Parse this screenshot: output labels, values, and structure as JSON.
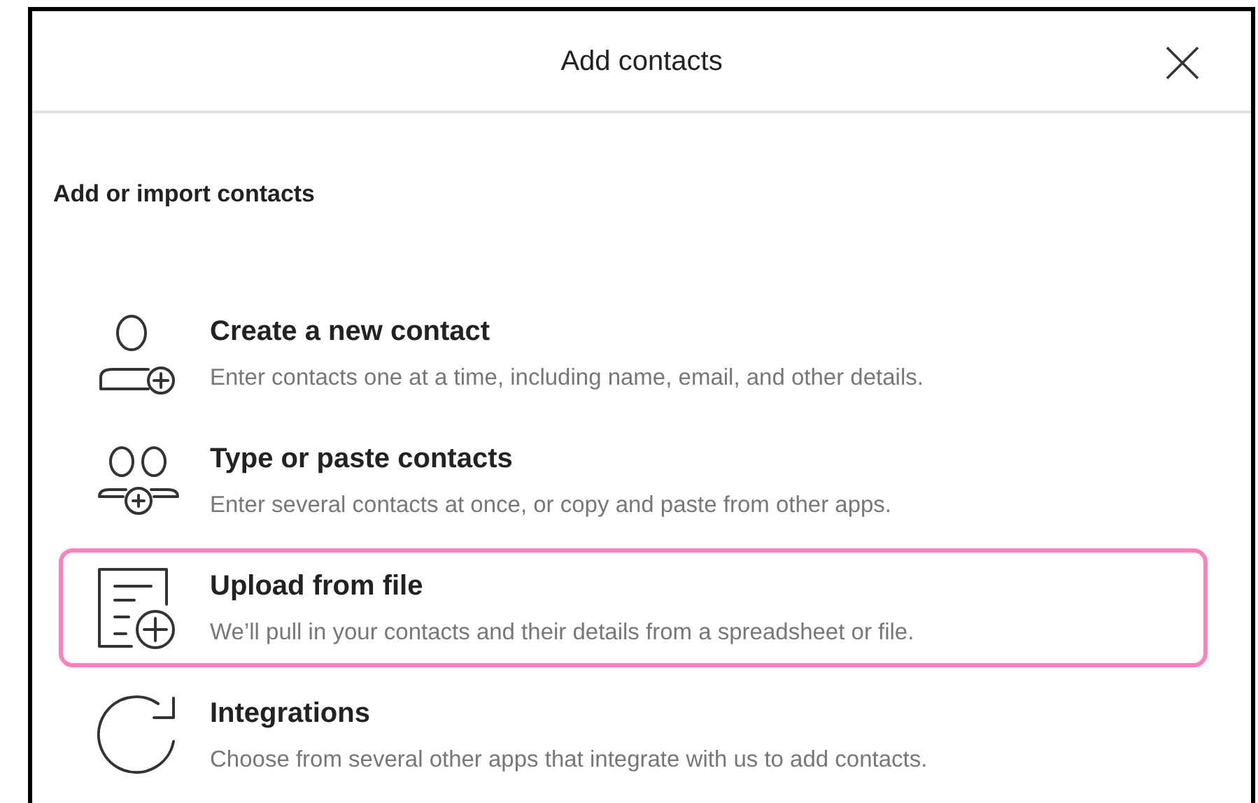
{
  "dialog": {
    "title": "Add contacts",
    "section_heading": "Add or import contacts",
    "options": [
      {
        "kind": "person",
        "title": "Create a new contact",
        "description": "Enter contacts one at a time, including name, email, and other details.",
        "selected": false
      },
      {
        "kind": "people",
        "title": "Type or paste contacts",
        "description": "Enter several contacts at once, or copy and paste from other apps.",
        "selected": false
      },
      {
        "kind": "file",
        "title": "Upload from file",
        "description": "We’ll pull in your contacts and their details from a spreadsheet or file.",
        "selected": true
      },
      {
        "kind": "sync",
        "title": "Integrations",
        "description": "Choose from several other apps that integrate with us to add contacts.",
        "selected": false
      }
    ]
  }
}
